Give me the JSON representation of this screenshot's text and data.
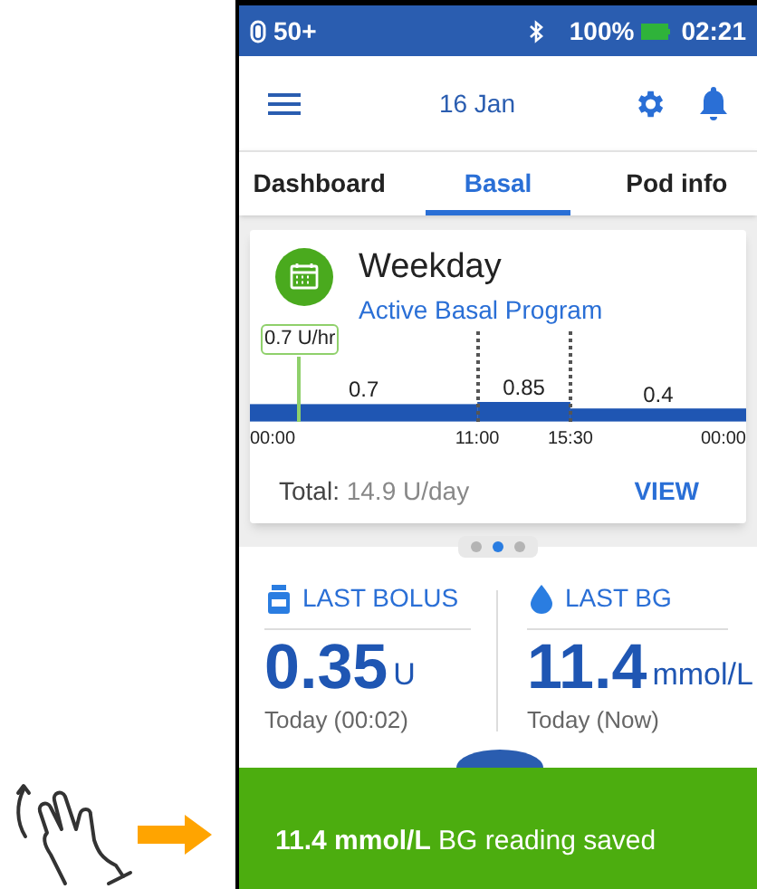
{
  "status_bar": {
    "pod_level": "50+",
    "battery": "100%",
    "time": "02:21"
  },
  "header": {
    "date": "16 Jan"
  },
  "tabs": [
    {
      "label": "Dashboard",
      "selected": false
    },
    {
      "label": "Basal",
      "selected": true
    },
    {
      "label": "Pod info",
      "selected": false
    }
  ],
  "basal_card": {
    "title": "Weekday",
    "subtitle": "Active Basal Program",
    "current_rate": "0.7 U/hr",
    "segments": [
      {
        "rate": "0.7",
        "start": "00:00"
      },
      {
        "rate": "0.85",
        "start": "11:00"
      },
      {
        "rate": "0.4",
        "start": "15:30"
      }
    ],
    "end": "00:00",
    "total_label": "Total:",
    "total_value": "14.9 U/day",
    "action": "VIEW"
  },
  "pager": [
    {
      "selected": false
    },
    {
      "selected": true
    },
    {
      "selected": false
    }
  ],
  "last_bolus": {
    "label": "LAST BOLUS",
    "value": "0.35",
    "unit": "U",
    "time": "Today (00:02)"
  },
  "last_bg": {
    "label": "LAST BG",
    "value": "11.4",
    "unit": "mmol/L",
    "time": "Today (Now)"
  },
  "toast": {
    "text": "**11.4 mmol/L** BG reading saved"
  }
}
